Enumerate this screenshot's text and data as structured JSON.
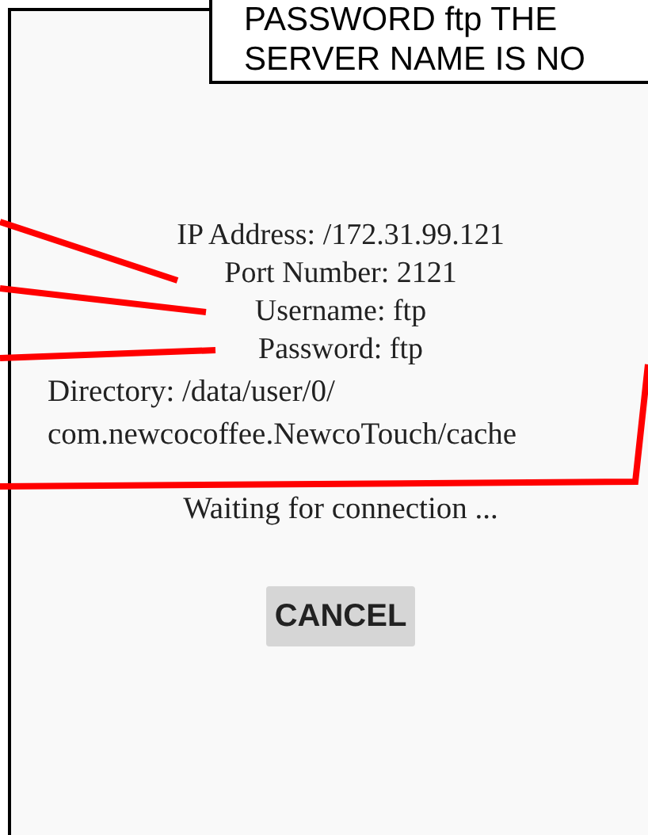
{
  "callout": {
    "lines": [
      "PASSWORD ftp THE",
      "SERVER NAME IS NO"
    ]
  },
  "server_info": [
    "IP Address: /172.31.99.121",
    "Port Number: 2121",
    "Username: ftp",
    "Password: ftp"
  ],
  "directory_lines": [
    "Directory: /data/user/0/",
    "com.newcocoffee.NewcoTouch/cache"
  ],
  "status": "Waiting for connection ...",
  "buttons": [
    "CANCEL"
  ]
}
